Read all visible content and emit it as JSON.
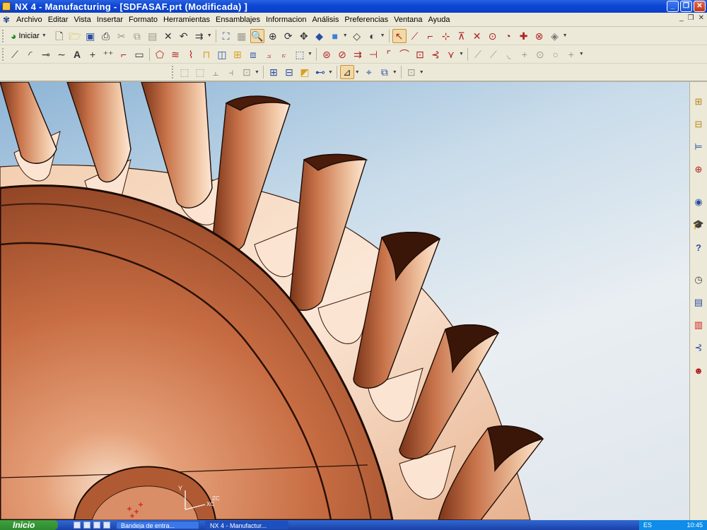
{
  "window": {
    "title": "NX 4 - Manufacturing - [SDFASAF.prt (Modificada) ]",
    "controls": {
      "minimize": "_",
      "restore": "❐",
      "close": "✕"
    }
  },
  "menu": {
    "items": [
      "Archivo",
      "Editar",
      "Vista",
      "Insertar",
      "Formato",
      "Herramientas",
      "Ensamblajes",
      "Informacion",
      "Análisis",
      "Preferencias",
      "Ventana",
      "Ayuda"
    ],
    "doc_controls": [
      "_",
      "❐",
      "✕"
    ]
  },
  "toolbar1": {
    "start_label": "Iniciar",
    "icons": [
      "new-file-icon",
      "open-folder-icon",
      "save-icon",
      "print-icon",
      "cut-icon",
      "copy-icon",
      "paste-icon",
      "delete-icon",
      "undo-icon",
      "repeat-command-icon"
    ]
  },
  "toolbar2": {
    "icons": [
      "line-icon",
      "arc-icon",
      "fillet-icon",
      "spline-icon",
      "text-icon",
      "point-icon",
      "point-set-icon",
      "corner-icon",
      "rectangle-icon"
    ]
  },
  "viewport": {
    "triad_labels": {
      "y": "Y",
      "x": "XC",
      "z": "ZC"
    }
  },
  "resource_bar": {
    "icons": [
      "assembly-navigator-icon",
      "part-navigator-icon",
      "operation-navigator-icon",
      "roles-icon",
      "web-browser-icon",
      "training-icon",
      "help-icon",
      "history-icon",
      "reuse-library-icon",
      "palette-icon",
      "process-studio-icon",
      "system-materials-icon"
    ]
  },
  "taskbar": {
    "start": "Inicio",
    "tasks": [
      {
        "label": "Bandeja de entra..."
      },
      {
        "label": "NX 4 - Manufactur..."
      }
    ],
    "tray": {
      "lang": "ES",
      "time": "10:45"
    }
  },
  "colors": {
    "title_bar": "#0d47d6",
    "chrome": "#ece9d8",
    "part_copper": "#c8734a",
    "part_highlight": "#f2c9a8",
    "background_top": "#8db4d6",
    "background_bottom": "#e9eef2"
  }
}
